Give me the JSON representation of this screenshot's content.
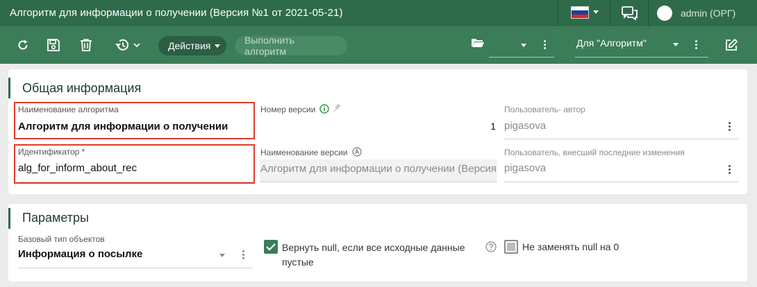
{
  "window": {
    "title": "Алгоритм для информации о получении (Версия №1 от 2021-05-21)",
    "user": "admin (ОРГ)"
  },
  "toolbar": {
    "actions_label": "Действия",
    "run_label": "Выполнить алгоритм",
    "context_select_value": "Для \"Алгоритм\""
  },
  "general": {
    "title": "Общая информация",
    "algorithm_name_label": "Наименование алгоритма",
    "algorithm_name_value": "Алгоритм для информации о получении",
    "identifier_label": "Идентификатор *",
    "identifier_value": "alg_for_inform_about_rec",
    "version_number_label": "Номер версии",
    "version_number_value": "1",
    "version_name_label": "Наименование версии",
    "version_name_value": "Алгоритм для информации о получении (Версия",
    "author_label": "Пользователь- автор",
    "author_value": "pigasova",
    "last_modifier_label": "Пользователь, внесший последние изменения",
    "last_modifier_value": "pigasova"
  },
  "params": {
    "title": "Параметры",
    "base_type_label": "Базовый тип объектов",
    "base_type_value": "Информация о посылке",
    "return_null_label_line1": "Вернуть null, если все исходные данные",
    "return_null_label_line2": "пустые",
    "return_null_checked": true,
    "no_replace_null_label": "Не заменять null на 0",
    "no_replace_null_checked": false
  },
  "colors": {
    "title_bar": "#2e6b4b",
    "toolbar": "#3b7d58",
    "highlight": "#e23b2a"
  }
}
